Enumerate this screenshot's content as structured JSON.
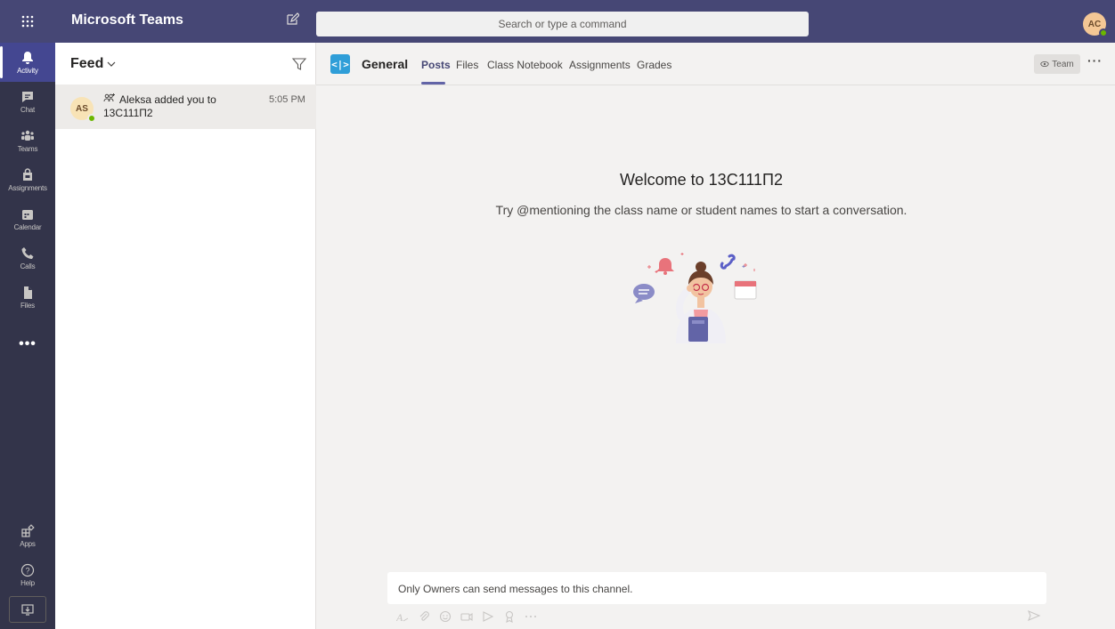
{
  "app": {
    "title": "Microsoft Teams",
    "search_placeholder": "Search or type a command",
    "user_initials": "AC"
  },
  "rail": {
    "items": [
      {
        "label": "Activity",
        "icon": "bell-icon",
        "active": true
      },
      {
        "label": "Chat",
        "icon": "chat-icon"
      },
      {
        "label": "Teams",
        "icon": "teams-icon"
      },
      {
        "label": "Assignments",
        "icon": "assignments-icon"
      },
      {
        "label": "Calendar",
        "icon": "calendar-icon"
      },
      {
        "label": "Calls",
        "icon": "phone-icon"
      },
      {
        "label": "Files",
        "icon": "file-icon"
      }
    ],
    "more": "•••",
    "bottom": [
      {
        "label": "Apps",
        "icon": "apps-icon"
      },
      {
        "label": "Help",
        "icon": "help-icon"
      }
    ]
  },
  "feed": {
    "title": "Feed",
    "items": [
      {
        "initials": "AS",
        "text": "Aleksa added you to",
        "subject": "13C111П2",
        "time": "5:05 PM"
      }
    ]
  },
  "channel": {
    "name": "General",
    "tabs": [
      "Posts",
      "Files",
      "Class Notebook",
      "Assignments",
      "Grades"
    ],
    "active_tab": "Posts",
    "team_button": "Team",
    "more": "···"
  },
  "welcome": {
    "title": "Welcome to 13C111П2",
    "subtitle": "Try @mentioning the class name or student names to start a conversation."
  },
  "composer": {
    "notice": "Only Owners can send messages to this channel."
  },
  "colors": {
    "topbar": "#464775",
    "rail": "#33344a",
    "accent": "#6264a7",
    "presence": "#6bb700",
    "channel_icon": "#2f9ed8"
  }
}
